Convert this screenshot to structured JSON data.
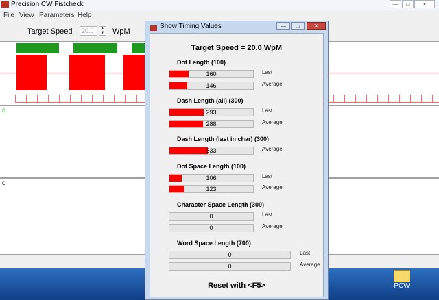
{
  "app": {
    "title": "Precision CW Fistcheck",
    "menu": [
      "File",
      "View",
      "Parameters",
      "Help"
    ],
    "toolbar": {
      "target_label": "Target Speed",
      "target_value": "20.0",
      "unit": "WpM"
    },
    "pane1_text": "q",
    "pane2_text": "q"
  },
  "desktop": {
    "icon_label": "PCW"
  },
  "dialog": {
    "title": "Show Timing Values",
    "target_speed": "Target Speed = 20.0 WpM",
    "reset": "Reset with <F5>",
    "groups": [
      {
        "title": "Dot Length (100)",
        "rows": [
          {
            "value": "160",
            "suffix": "Last",
            "fill": 0.23
          },
          {
            "value": "146",
            "suffix": "Average",
            "fill": 0.21
          }
        ]
      },
      {
        "title": "Dash Length (all) (300)",
        "rows": [
          {
            "value": "293",
            "suffix": "Last",
            "fill": 0.41
          },
          {
            "value": "288",
            "suffix": "Average",
            "fill": 0.4
          }
        ]
      },
      {
        "title": "Dash Length (last in char) (300)",
        "rows": [
          {
            "value": "333",
            "suffix": "Average",
            "fill": 0.46
          }
        ]
      },
      {
        "title": "Dot Space Length (100)",
        "rows": [
          {
            "value": "106",
            "suffix": "Last",
            "fill": 0.15
          },
          {
            "value": "123",
            "suffix": "Average",
            "fill": 0.17
          }
        ]
      },
      {
        "title": "Character Space Length (300)",
        "rows": [
          {
            "value": "0",
            "suffix": "Last",
            "fill": 0
          },
          {
            "value": "0",
            "suffix": "Average",
            "fill": 0
          }
        ]
      },
      {
        "title": "Word Space Length (700)",
        "rows": [
          {
            "value": "0",
            "suffix": "Last",
            "fill": 0
          },
          {
            "value": "0",
            "suffix": "Average",
            "fill": 0
          }
        ]
      }
    ]
  },
  "colors": {
    "element_bar": "#ff0000",
    "gap_bar": "#1d9a1d"
  }
}
